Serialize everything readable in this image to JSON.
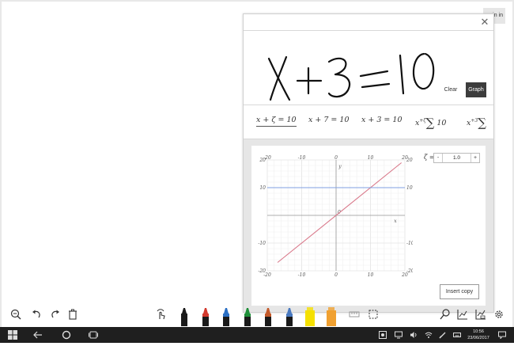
{
  "top_right": {
    "signin_label": "in in"
  },
  "math_panel": {
    "close_glyph": "✕",
    "clear_label": "Clear",
    "graph_label": "Graph",
    "ink_text": "x+3=10",
    "candidates": [
      {
        "label": "x + ζ = 10",
        "selected": true
      },
      {
        "label": "x + 7 = 10",
        "selected": false
      },
      {
        "label": "x + 3 = 10",
        "selected": false
      },
      {
        "label": "x^+ζ ∑ 10",
        "selected": false
      },
      {
        "label": "x^+3 ∑",
        "selected": false
      }
    ],
    "slider": {
      "variable": "ζ =",
      "minus": "-",
      "value": "1.0",
      "plus": "+"
    },
    "insert_label": "Insert copy"
  },
  "chart_data": {
    "type": "line",
    "xlim": [
      -20,
      20
    ],
    "ylim": [
      -20,
      20
    ],
    "xlabel": "x",
    "ylabel": "y",
    "x_ticks": [
      -20,
      -10,
      0,
      10,
      20
    ],
    "y_ticks": [
      -20,
      -10,
      0,
      10,
      20
    ],
    "grid": true,
    "series": [
      {
        "color": "#d9788a",
        "x": [
          -17,
          19
        ],
        "y": [
          -17,
          19
        ]
      },
      {
        "color": "#7f9fe0",
        "x": [
          -20,
          20
        ],
        "y": [
          10,
          10
        ]
      }
    ]
  },
  "toolbar": {
    "icons": [
      "zoom-out-icon",
      "undo-icon",
      "redo-icon",
      "delete-icon",
      "touch-write-icon"
    ],
    "pens": [
      {
        "name": "pen-black",
        "color": "#1a1a1a"
      },
      {
        "name": "pen-red",
        "color": "#d23a2e"
      },
      {
        "name": "pen-blue",
        "color": "#2a6fc4"
      },
      {
        "name": "pen-green",
        "color": "#1f8f3a"
      },
      {
        "name": "pen-galaxy",
        "color": "#c45a2a"
      },
      {
        "name": "pen-multi",
        "color": "#4a7ac0"
      },
      {
        "name": "highlighter-yellow",
        "color": "#f5e000"
      },
      {
        "name": "highlighter-orange",
        "color": "#f0a030"
      }
    ],
    "right_icons": [
      "ruler-icon",
      "select-icon",
      "search-icon",
      "graph-icon",
      "table-graph-icon",
      "settings-icon"
    ]
  },
  "taskbar": {
    "time": "10:56",
    "date": "23/06/2017"
  }
}
